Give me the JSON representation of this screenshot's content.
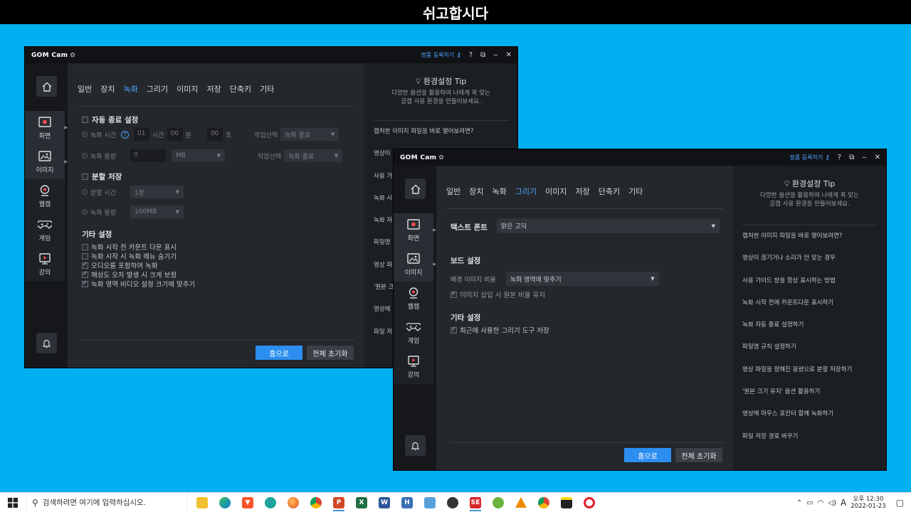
{
  "banner": {
    "title": "쉬고합시다"
  },
  "app": {
    "logo": "GOM Cam",
    "register": "정품 등록하기",
    "help": "?",
    "nav": [
      "일반",
      "장치",
      "녹화",
      "그리기",
      "이미지",
      "저장",
      "단축키",
      "기타"
    ],
    "sidebar": {
      "screen": "화면",
      "image": "이미지",
      "webcam": "웹캠",
      "game": "게임",
      "lecture": "강의"
    },
    "tip": {
      "title": "환경설정 Tip",
      "desc1": "다양한 옵션을 활용하여 나에게 꼭 맞는",
      "desc2": "곰캠 사용 환경을 만들어보세요.",
      "items": [
        "캡처한 이미지 파일을 바로 열어보려면?",
        "영상이 끊기거나 소리가 안 맞는 경우",
        "사용 가이드 창을 항상 표시하는 방법",
        "녹화 시작 전에 카운트다운 표시하기",
        "녹화 자동 종료 설정하기",
        "파일명 규칙 설정하기",
        "영상 파일을 정해진 용량으로 분할 저장하기",
        "'원본 크기 유지' 옵션 활용하기",
        "영상에 마우스 포인터 함께 녹화하기",
        "파일 저장 경로 바꾸기"
      ],
      "partial_back": [
        "캡처한 이미지 파일을 바로 열어보려면?",
        "영상이",
        "사용 가",
        "녹화 시",
        "녹화 자",
        "파일명",
        "영상 파",
        "'원본 크",
        "영상에",
        "파일 저"
      ]
    },
    "footer": {
      "home": "홈으로",
      "reset": "전체 초기화"
    }
  },
  "back_window": {
    "active_tab": "녹화",
    "auto_stop": {
      "title": "자동 종료 설정",
      "time_label": "녹화 시간",
      "hour": "01",
      "hour_unit": "시간",
      "min": "00",
      "min_unit": "분",
      "sec": "00",
      "sec_unit": "초",
      "action_label": "작업선택",
      "action_value": "녹화 종료",
      "size_label": "녹화 용량",
      "size_value": "0",
      "size_unit": "MB"
    },
    "split": {
      "title": "분할 저장",
      "time_label": "분할 시간",
      "time_value": "1분",
      "size_label": "녹화 용량",
      "size_value": "100MB"
    },
    "etc": {
      "title": "기타 설정",
      "options": [
        {
          "label": "녹화 시작 전 카운트 다운 표시",
          "checked": false
        },
        {
          "label": "녹화 시작 시 녹화 메뉴 숨기기",
          "checked": false
        },
        {
          "label": "오디오를 포함하여 녹화",
          "checked": true
        },
        {
          "label": "해상도 오차 발생 시 크게 보정",
          "checked": true
        },
        {
          "label": "녹화 영역 비디오 설정 크기에 맞추기",
          "checked": true
        }
      ]
    }
  },
  "front_window": {
    "active_tab": "그리기",
    "font": {
      "label": "텍스트 폰트",
      "value": "맑은 고딕"
    },
    "board": {
      "title": "보드 설정",
      "ratio_label": "배경 이미지 비율",
      "ratio_value": "녹화 영역에 맞추기",
      "keep_ratio": "이미지 삽입 시 원본 비율 유지"
    },
    "etc": {
      "title": "기타 설정",
      "save_tool": "최근에 사용한 그리기 도구 저장"
    }
  },
  "taskbar": {
    "search_placeholder": "검색하려면 여기에 입력하십시오.",
    "lang": "A",
    "time": "오후 12:30",
    "date": "2022-01-23"
  }
}
